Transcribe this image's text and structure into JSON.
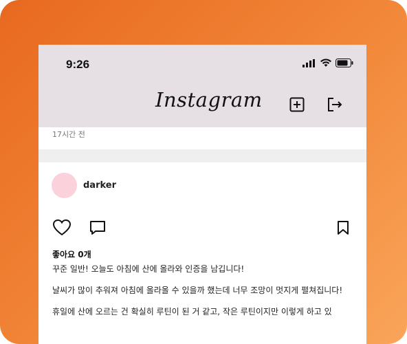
{
  "status_bar": {
    "time": "9:26"
  },
  "header": {
    "logo": "Instagram",
    "add_icon": "plus-square-icon",
    "logout_icon": "logout-icon"
  },
  "previous_post": {
    "time_ago": "17시간 전"
  },
  "post": {
    "username": "darker",
    "likes": "좋아요 0개",
    "caption": [
      "꾸준 일반! 오늘도 아침에 산에 올라와 인증을 남깁니다!",
      "날씨가 많이 추워져 아침에 올라올 수 있을까 했는데 너무 조망이 멋지게 펼쳐집니다!",
      "휴일에 산에 오르는 건 확실히 루틴이 된 거 같고, 작은 루틴이지만 이렇게 하고 있"
    ]
  },
  "colors": {
    "background_gradient_start": "#e8691f",
    "background_gradient_end": "#f9a55a",
    "header_bg": "#e6e0e4",
    "avatar": "#fbd2dc"
  }
}
